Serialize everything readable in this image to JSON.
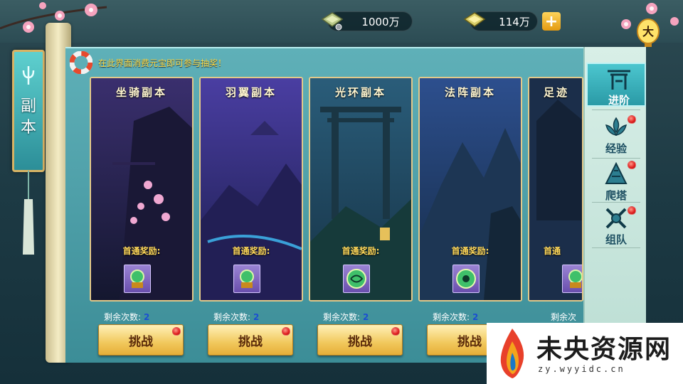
{
  "currencies": [
    {
      "name": "silver",
      "amount": "1000万",
      "icon": "silver-ingot-icon"
    },
    {
      "name": "gold",
      "amount": "114万",
      "icon": "gold-ingot-icon"
    }
  ],
  "top_right": {
    "lantern_char": "大"
  },
  "left_banner": {
    "label": "副本"
  },
  "notice": {
    "text": "在此界面消费元宝即可参与抽奖！"
  },
  "dungeons": [
    {
      "title": "坐骑副本",
      "reward_label": "首通奖励:",
      "remain_label": "剩余次数:",
      "remain_count": "2",
      "button": "挑战",
      "reward_icon": "gem-chest-icon",
      "has_dot": true
    },
    {
      "title": "羽翼副本",
      "reward_label": "首通奖励:",
      "remain_label": "剩余次数:",
      "remain_count": "2",
      "button": "挑战",
      "reward_icon": "gem-chest-icon",
      "has_dot": true
    },
    {
      "title": "光环副本",
      "reward_label": "首通奖励:",
      "remain_label": "剩余次数:",
      "remain_count": "2",
      "button": "挑战",
      "reward_icon": "green-orb-icon",
      "has_dot": true
    },
    {
      "title": "法阵副本",
      "reward_label": "首通奖励:",
      "remain_label": "剩余次数:",
      "remain_count": "2",
      "button": "挑战",
      "reward_icon": "green-orb-icon",
      "has_dot": true
    },
    {
      "title": "足迹",
      "reward_label": "首通",
      "remain_label": "剩余次",
      "remain_count": "",
      "button": "",
      "reward_icon": "gem-chest-icon",
      "has_dot": false
    }
  ],
  "tabs": [
    {
      "label": "进阶",
      "icon": "gate-icon",
      "active": true,
      "dot": false
    },
    {
      "label": "经验",
      "icon": "lotus-icon",
      "active": false,
      "dot": true
    },
    {
      "label": "爬塔",
      "icon": "tower-icon",
      "active": false,
      "dot": true
    },
    {
      "label": "组队",
      "icon": "crossed-swords-icon",
      "active": false,
      "dot": true
    }
  ],
  "watermark": {
    "title": "未央资源网",
    "url": "zy.wyyidc.cn"
  },
  "colors": {
    "panel": "#4fa1aa",
    "gold_text": "#ffde4a",
    "button": "#f1c85c",
    "count": "#1a4fd1"
  }
}
